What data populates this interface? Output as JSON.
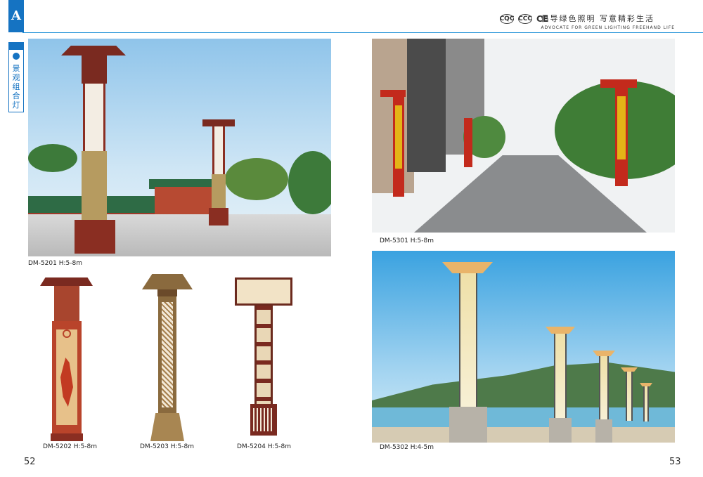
{
  "header": {
    "tab_letter": "A",
    "section_label": "景观组合灯",
    "certs": [
      "CQC",
      "CCC",
      "CE"
    ],
    "slogan_cn": "倡导绿色照明  写意精彩生活",
    "slogan_en": "ADVOCATE FOR GREEN LIGHTING FREEHAND LIFE"
  },
  "products": [
    {
      "code": "DM-5201",
      "height": "H:5-8m"
    },
    {
      "code": "DM-5202",
      "height": "H:5-8m"
    },
    {
      "code": "DM-5203",
      "height": "H:5-8m"
    },
    {
      "code": "DM-5204",
      "height": "H:5-8m"
    },
    {
      "code": "DM-5301",
      "height": "H:5-8m"
    },
    {
      "code": "DM-5302",
      "height": "H:4-5m"
    }
  ],
  "captions": {
    "p5201": "DM-5201  H:5-8m",
    "p5202": "DM-5202  H:5-8m",
    "p5203": "DM-5203  H:5-8m",
    "p5204": "DM-5204  H:5-8m",
    "p5301": "DM-5301  H:5-8m",
    "p5302": "DM-5302  H:4-5m"
  },
  "page_numbers": {
    "left": "52",
    "right": "53"
  },
  "colors": {
    "accent": "#1573c2",
    "header_line": "#1a8ed6"
  }
}
